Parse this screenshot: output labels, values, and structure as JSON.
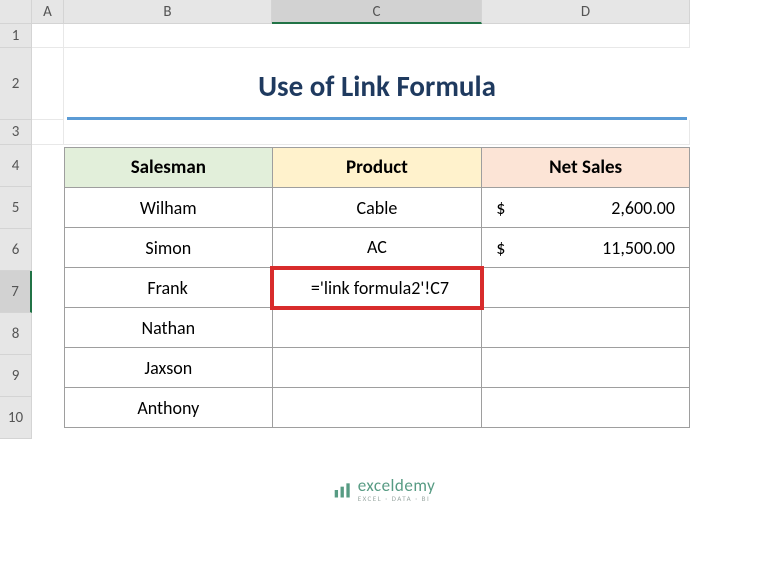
{
  "columns": [
    "",
    "A",
    "B",
    "C",
    "D"
  ],
  "active_column_index": 3,
  "row_headers_top": [
    "1",
    "2",
    "3"
  ],
  "row_headers_data": [
    "4",
    "5",
    "6",
    "7",
    "8",
    "9",
    "10"
  ],
  "active_row": "7",
  "title": "Use of Link Formula",
  "headers": {
    "salesman": "Salesman",
    "product": "Product",
    "netsales": "Net Sales"
  },
  "data_rows": [
    {
      "salesman": "Wilham",
      "product": "Cable",
      "currency": "$",
      "netsales": "2,600.00"
    },
    {
      "salesman": "Simon",
      "product": "AC",
      "currency": "$",
      "netsales": "11,500.00"
    },
    {
      "salesman": "Frank",
      "product": "='link formula2'!C7",
      "currency": "",
      "netsales": ""
    },
    {
      "salesman": "Nathan",
      "product": "",
      "currency": "",
      "netsales": ""
    },
    {
      "salesman": "Jaxson",
      "product": "",
      "currency": "",
      "netsales": ""
    },
    {
      "salesman": "Anthony",
      "product": "",
      "currency": "",
      "netsales": ""
    }
  ],
  "formula_row_index": 2,
  "watermark": {
    "main": "exceldemy",
    "sub": "EXCEL · DATA · BI"
  }
}
